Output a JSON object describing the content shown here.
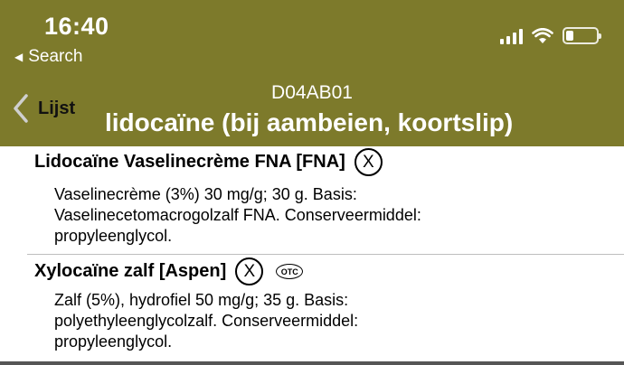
{
  "status_bar": {
    "time": "16:40",
    "back_label": "Search"
  },
  "nav": {
    "back_label": "Lijst",
    "code": "D04AB01",
    "title": "lidocaïne (bij aambeien, koortslip)"
  },
  "products": [
    {
      "name": "Lidocaïne Vaselinecrème FNA [FNA]",
      "x_symbol": "X",
      "description_lines": [
        "Vaselinecrème (3%) 30 mg/g; 30 g. Basis:",
        "Vaselinecetomacrogolzalf FNA. Conserveermiddel:",
        "propyleenglycol."
      ]
    },
    {
      "name": "Xylocaïne zalf [Aspen]",
      "x_symbol": "X",
      "otc_label": "OTC",
      "description_lines": [
        "Zalf (5%), hydrofiel 50 mg/g; 35 g. Basis:",
        "polyethyleenglycolzalf. Conserveermiddel:",
        "propyleenglycol."
      ]
    }
  ],
  "colors": {
    "header_bg": "#7d7a2b",
    "header_text": "#ffffff",
    "back_chevron": "#cfcfcf"
  }
}
